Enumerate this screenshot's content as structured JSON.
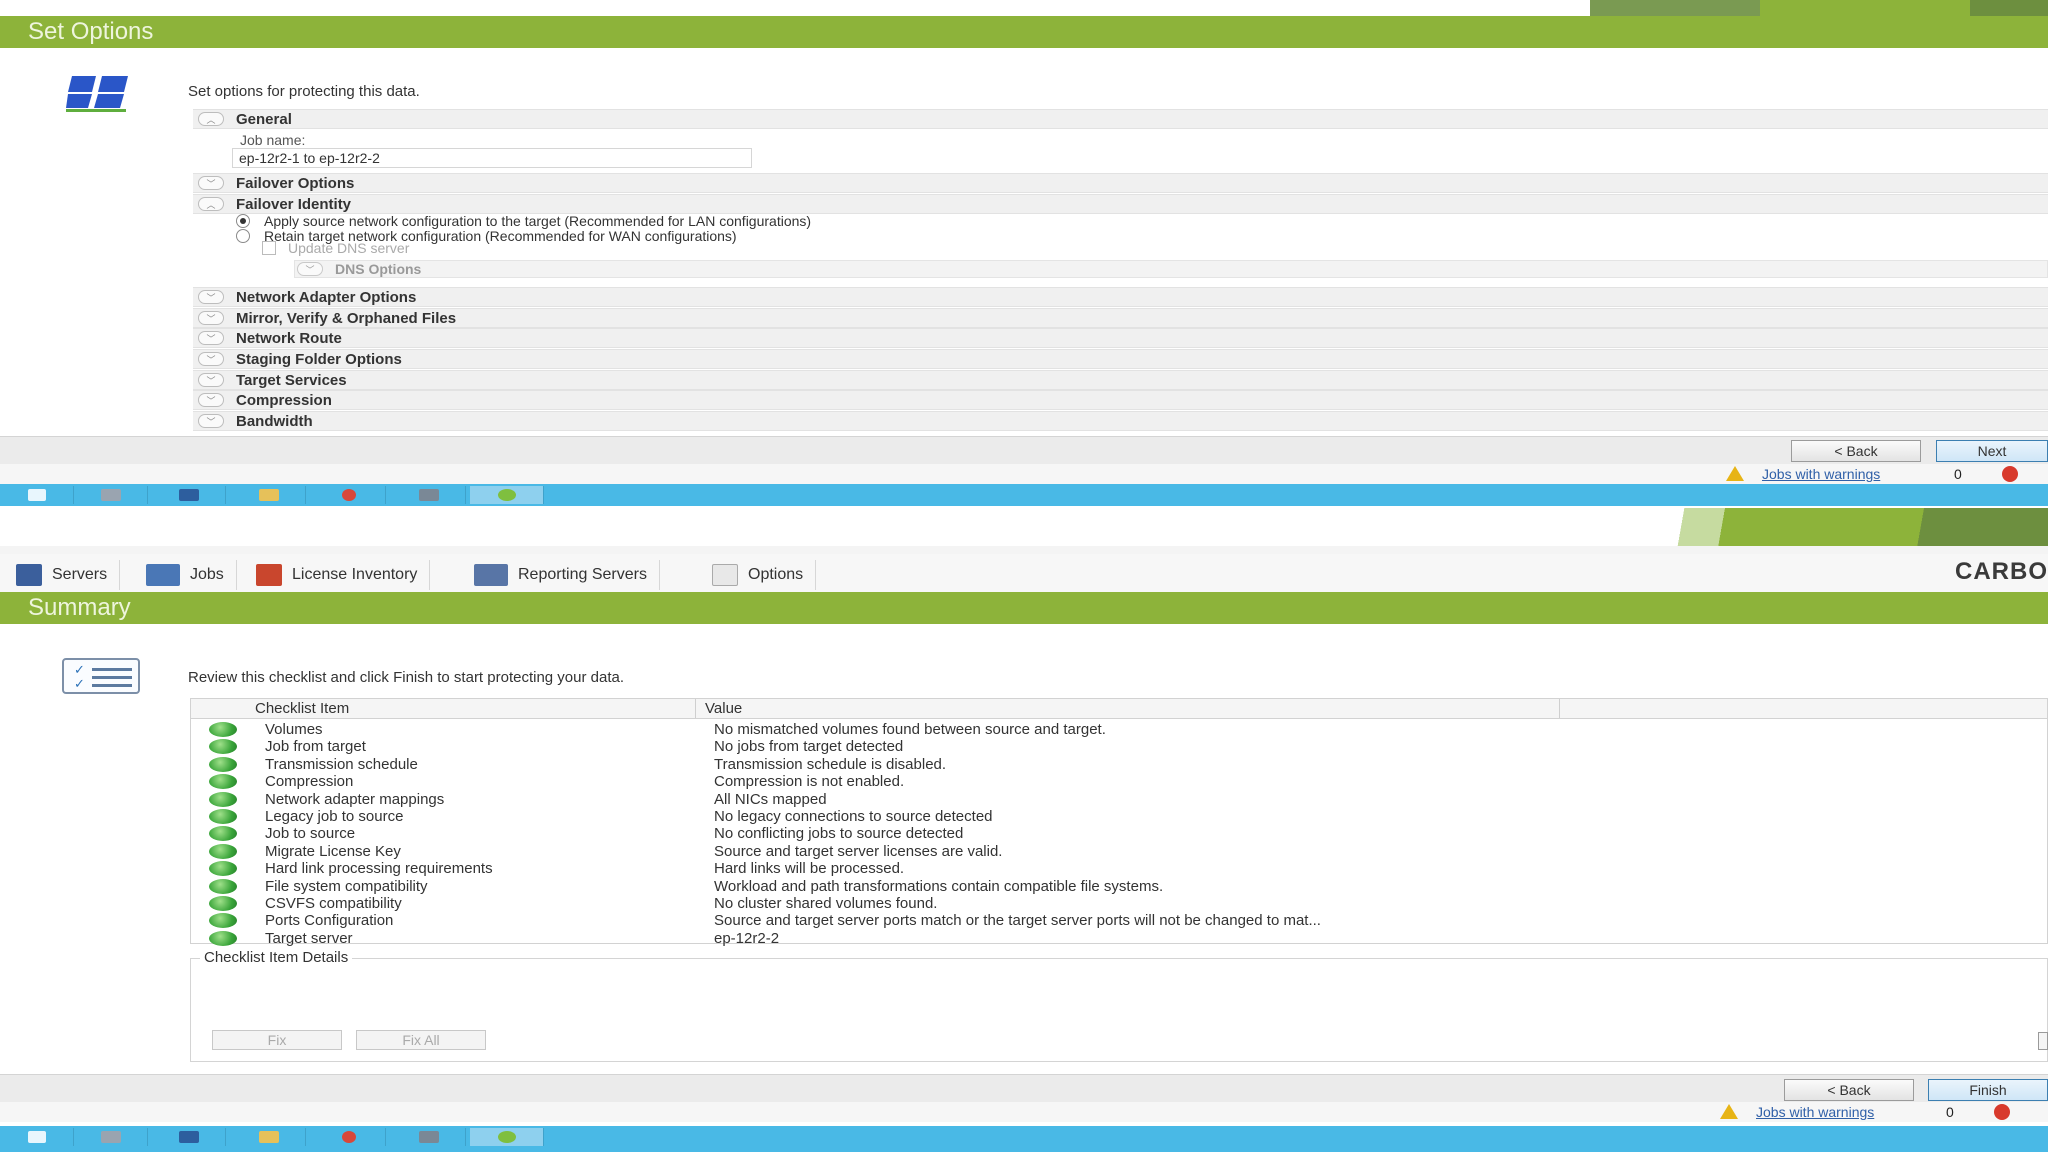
{
  "top": {
    "header_title": "Set Options",
    "intro": "Set options for protecting this data.",
    "sections": {
      "general": "General",
      "failover_options": "Failover Options",
      "failover_identity": "Failover Identity",
      "network_adapter_options": "Network Adapter Options",
      "mirror_verify": "Mirror, Verify & Orphaned Files",
      "network_route": "Network Route",
      "staging_folder": "Staging Folder Options",
      "target_services": "Target Services",
      "compression": "Compression",
      "bandwidth": "Bandwidth"
    },
    "job_name_label": "Job name:",
    "job_name_value": "ep-12r2-1 to ep-12r2-2",
    "radio_apply": "Apply source network configuration to the target (Recommended for LAN configurations)",
    "radio_retain": "Retain target network configuration (Recommended for WAN configurations)",
    "update_dns": "Update DNS server",
    "dns_options": "DNS Options",
    "back_label": "< Back",
    "next_label": "Next",
    "jobs_warnings_label": "Jobs with warnings",
    "jobs_warnings_count": "0"
  },
  "bottom": {
    "toolbar": {
      "servers": "Servers",
      "jobs": "Jobs",
      "license_inventory": "License Inventory",
      "reporting_servers": "Reporting Servers",
      "options": "Options"
    },
    "brand": "CARBO",
    "header_title": "Summary",
    "intro": "Review this checklist and click Finish to start protecting your data.",
    "columns": {
      "item": "Checklist Item",
      "value": "Value"
    },
    "rows": [
      {
        "item": "Volumes",
        "value": "No mismatched volumes found between source and target."
      },
      {
        "item": "Job from target",
        "value": "No jobs from target detected"
      },
      {
        "item": "Transmission schedule",
        "value": "Transmission schedule is disabled."
      },
      {
        "item": "Compression",
        "value": "Compression is not enabled."
      },
      {
        "item": "Network adapter mappings",
        "value": "All NICs mapped"
      },
      {
        "item": "Legacy job to source",
        "value": "No legacy connections to source detected"
      },
      {
        "item": "Job to source",
        "value": "No conflicting jobs to source detected"
      },
      {
        "item": "Migrate License Key",
        "value": "Source and target server licenses are valid."
      },
      {
        "item": "Hard link processing requirements",
        "value": "Hard links will be processed."
      },
      {
        "item": "File system compatibility",
        "value": "Workload and path transformations contain compatible file systems."
      },
      {
        "item": "CSVFS compatibility",
        "value": "No cluster shared volumes found."
      },
      {
        "item": "Ports Configuration",
        "value": "Source and target server ports match or the target server ports will not be changed to mat..."
      },
      {
        "item": "Target server",
        "value": "ep-12r2-2"
      }
    ],
    "details_label": "Checklist Item Details",
    "fix_label": "Fix",
    "fix_all_label": "Fix All",
    "back_label": "< Back",
    "finish_label": "Finish",
    "jobs_warnings_label": "Jobs with warnings",
    "jobs_warnings_count": "0"
  },
  "colors": {
    "header_green": "#8db33a",
    "taskbar_blue": "#49b9e6",
    "ok_green": "#3aa53a",
    "warning_yellow": "#e7b416",
    "error_red": "#d83a2c"
  }
}
